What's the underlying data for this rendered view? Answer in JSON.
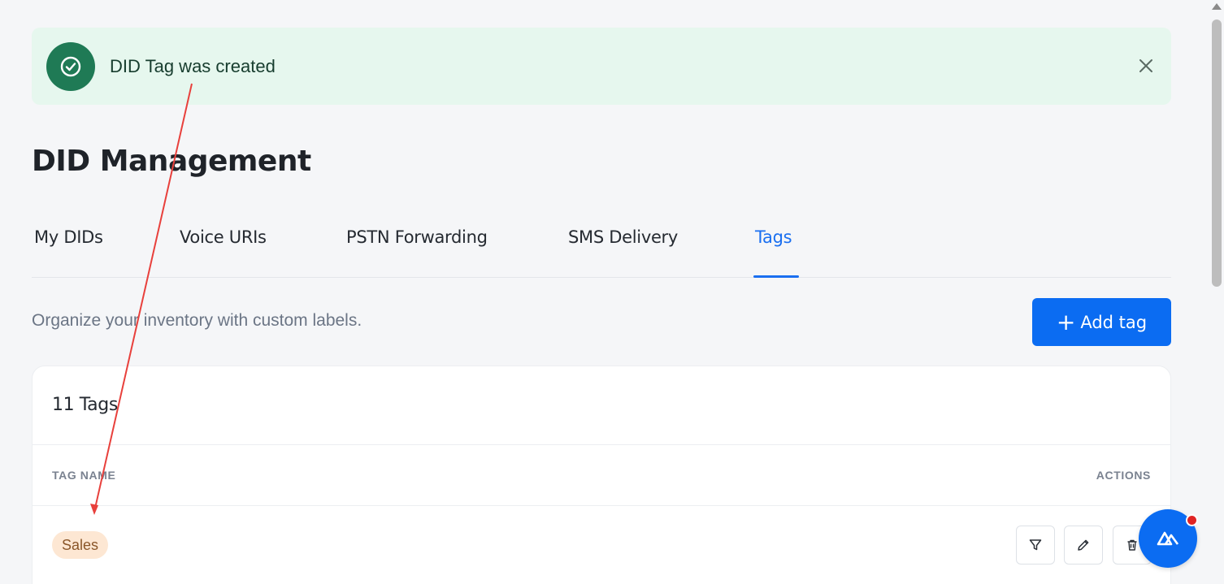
{
  "toast": {
    "message": "DID Tag was created",
    "icon": "check-circle-icon",
    "close_icon": "close-icon"
  },
  "page": {
    "title": "DID Management"
  },
  "tabs": [
    {
      "label": "My DIDs"
    },
    {
      "label": "Voice URIs"
    },
    {
      "label": "PSTN Forwarding"
    },
    {
      "label": "SMS Delivery"
    },
    {
      "label": "Tags",
      "active": true
    }
  ],
  "description": "Organize your inventory with custom labels.",
  "add_button": {
    "label": "Add tag",
    "icon": "plus-icon"
  },
  "card": {
    "count_label": "11 Tags",
    "columns": {
      "name": "TAG NAME",
      "actions": "ACTIONS"
    },
    "rows": [
      {
        "tag": "Sales",
        "actions": [
          "filter-icon",
          "pencil-icon",
          "trash-icon"
        ]
      }
    ]
  },
  "colors": {
    "accent": "#0b6cf2",
    "toast_bg": "#e6f7ee",
    "toast_icon": "#1f7a55",
    "tag_bg": "#fde7d3",
    "tag_text": "#8a5629",
    "annotation": "#e8403c"
  }
}
